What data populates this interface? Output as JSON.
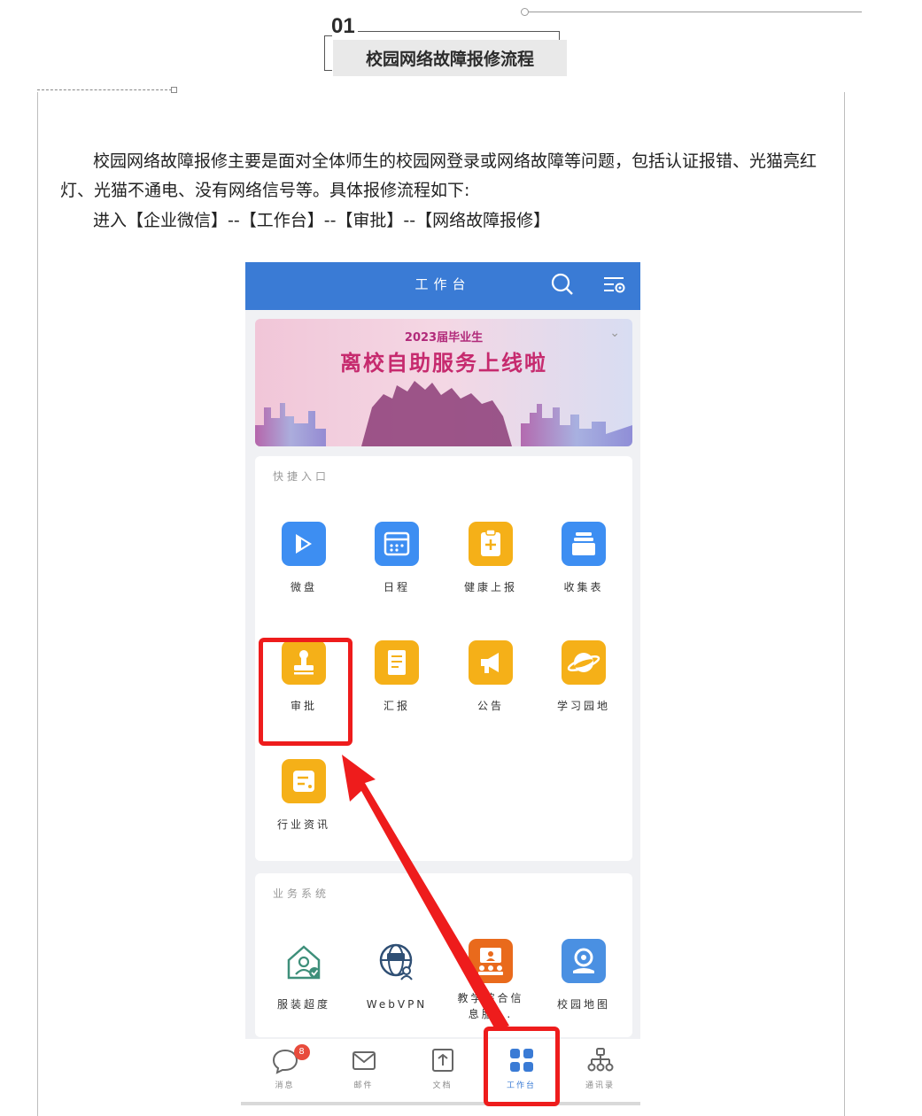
{
  "section": {
    "number": "01",
    "title": "校园网络故障报修流程"
  },
  "body": {
    "paragraph1": "校园网络故障报修主要是面对全体师生的校园网登录或网络故障等问题，包括认证报错、光猫亮红灯、光猫不通电、没有网络信号等。具体报修流程如下:",
    "paragraph2": "进入【企业微信】--【工作台】--【审批】--【网络故障报修】"
  },
  "phone": {
    "header_title": "工作台",
    "banner": {
      "subtitle": "2023届毕业生",
      "title": "离校自助服务上线啦"
    },
    "quick_section": {
      "title": "快捷入口",
      "apps": [
        {
          "label": "微盘",
          "icon": "cloud-drive-icon",
          "color": "#3d8ef2"
        },
        {
          "label": "日程",
          "icon": "calendar-icon",
          "color": "#3d8ef2"
        },
        {
          "label": "健康上报",
          "icon": "health-report-icon",
          "color": "#f5b018"
        },
        {
          "label": "收集表",
          "icon": "collection-form-icon",
          "color": "#3d8ef2"
        },
        {
          "label": "审批",
          "icon": "approval-stamp-icon",
          "color": "#f5b018"
        },
        {
          "label": "汇报",
          "icon": "report-icon",
          "color": "#f5b018"
        },
        {
          "label": "公告",
          "icon": "announcement-icon",
          "color": "#f5b018"
        },
        {
          "label": "学习园地",
          "icon": "planet-icon",
          "color": "#f5b018"
        },
        {
          "label": "行业资讯",
          "icon": "news-icon",
          "color": "#f5b018"
        }
      ]
    },
    "business_section": {
      "title": "业务系统",
      "apps": [
        {
          "label": "服装超度",
          "icon": "house-user-icon"
        },
        {
          "label": "WebVPN",
          "icon": "vpn-globe-icon"
        },
        {
          "label": "教学综合信息服...",
          "icon": "teaching-info-icon"
        },
        {
          "label": "校园地图",
          "icon": "map-pin-icon"
        }
      ]
    },
    "tabbar": [
      {
        "label": "消息",
        "icon": "chat-bubble-icon",
        "badge": "8"
      },
      {
        "label": "邮件",
        "icon": "mail-icon"
      },
      {
        "label": "文档",
        "icon": "document-icon"
      },
      {
        "label": "工作台",
        "icon": "grid-icon",
        "active": true
      },
      {
        "label": "通讯录",
        "icon": "org-chart-icon"
      }
    ]
  },
  "colors": {
    "header_blue": "#3a7bd5",
    "highlight_red": "#ee1c1c",
    "accent_yellow": "#f5b018"
  }
}
